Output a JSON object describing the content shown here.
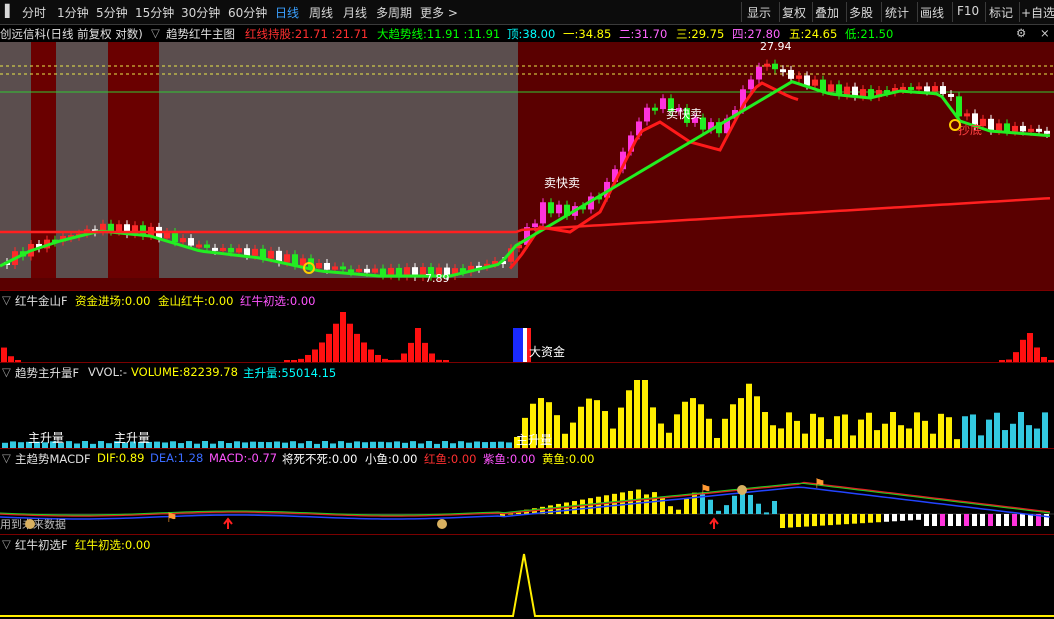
{
  "toolbar": {
    "periods": [
      "分时",
      "1分钟",
      "5分钟",
      "15分钟",
      "30分钟",
      "60分钟",
      "日线",
      "周线",
      "月线",
      "多周期",
      "更多 >"
    ],
    "active_period": "日线",
    "actions": [
      "显示",
      "复权",
      "叠加",
      "多股",
      "统计",
      "画线",
      "F10",
      "标记",
      "+自选"
    ]
  },
  "main_panel": {
    "title": "创远信科(日线 前复权 对数)",
    "indicator": "趋势红牛主图",
    "stats": [
      {
        "label": "红线持股:",
        "value": "21.71 :21.71",
        "color": "#ff3030"
      },
      {
        "label": "大趋势线:",
        "value": "11.91 :11.91",
        "color": "#00ff00"
      },
      {
        "label": "顶:",
        "value": "38.00",
        "color": "#00ffff"
      },
      {
        "label": "一:",
        "value": "34.85",
        "color": "#ffff00"
      },
      {
        "label": "二:",
        "value": "31.70",
        "color": "#ff66ff"
      },
      {
        "label": "三:",
        "value": "29.75",
        "color": "#ffff00"
      },
      {
        "label": "四:",
        "value": "27.80",
        "color": "#ff66ff"
      },
      {
        "label": "五:",
        "value": "24.65",
        "color": "#ffff00"
      },
      {
        "label": "低:",
        "value": "21.50",
        "color": "#00ff00"
      }
    ],
    "price_labels": {
      "high": "27.94",
      "low": "7.89"
    },
    "annotations": [
      "卖快卖",
      "卖快卖",
      "抄底",
      "Q"
    ]
  },
  "panel_jinshan": {
    "title": "红牛金山F",
    "stats": [
      {
        "label": "资金进场:",
        "value": "0.00",
        "color": "#ffff00"
      },
      {
        "label": "金山红牛:",
        "value": "0.00",
        "color": "#ffff00"
      },
      {
        "label": "红牛初选:",
        "value": "0.00",
        "color": "#ff55ff"
      }
    ],
    "annotation": "大资金"
  },
  "panel_volume": {
    "title": "趋势主升量F",
    "stats": [
      {
        "label": "VVOL:",
        "value": "-",
        "color": "#dddddd"
      },
      {
        "label": "VOLUME:",
        "value": "82239.78",
        "color": "#ffff00"
      },
      {
        "label": "主升量:",
        "value": "55014.15",
        "color": "#00ffff"
      }
    ],
    "annotations": [
      "主升量",
      "主升量",
      "主升量"
    ]
  },
  "panel_macd": {
    "title": "主趋势MACDF",
    "stats": [
      {
        "label": "DIF:",
        "value": "0.89",
        "color": "#ffff00"
      },
      {
        "label": "DEA:",
        "value": "1.28",
        "color": "#3a6bff"
      },
      {
        "label": "MACD:",
        "value": "-0.77",
        "color": "#ff55ff"
      },
      {
        "label": "将死不死:",
        "value": "0.00",
        "color": "#ffffff"
      },
      {
        "label": "小鱼:",
        "value": "0.00",
        "color": "#ffffff"
      },
      {
        "label": "红鱼:",
        "value": "0.00",
        "color": "#ff3030"
      },
      {
        "label": "紫鱼:",
        "value": "0.00",
        "color": "#ff55ff"
      },
      {
        "label": "黄鱼:",
        "value": "0.00",
        "color": "#ffff00"
      }
    ],
    "side_note": "用到未来数据"
  },
  "panel_chuxuan": {
    "title": "红牛初选F",
    "stats": [
      {
        "label": "红牛初选:",
        "value": "0.00",
        "color": "#ffff00"
      }
    ]
  }
}
